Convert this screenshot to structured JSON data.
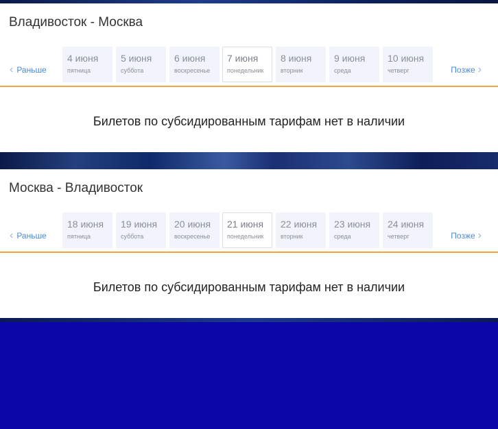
{
  "sections": [
    {
      "route": "Владивосток - Москва",
      "prev_label": "Раньше",
      "next_label": "Позже",
      "dates": [
        {
          "date": "4 июня",
          "weekday": "пятница"
        },
        {
          "date": "5 июня",
          "weekday": "суббота"
        },
        {
          "date": "6 июня",
          "weekday": "воскресенье"
        },
        {
          "date": "7 июня",
          "weekday": "понедельник"
        },
        {
          "date": "8 июня",
          "weekday": "вторник"
        },
        {
          "date": "9 июня",
          "weekday": "среда"
        },
        {
          "date": "10 июня",
          "weekday": "четверг"
        }
      ],
      "message": "Билетов по субсидированным тарифам нет в наличии"
    },
    {
      "route": "Москва - Владивосток",
      "prev_label": "Раньше",
      "next_label": "Позже",
      "dates": [
        {
          "date": "18 июня",
          "weekday": "пятница"
        },
        {
          "date": "19 июня",
          "weekday": "суббота"
        },
        {
          "date": "20 июня",
          "weekday": "воскресенье"
        },
        {
          "date": "21 июня",
          "weekday": "понедельник"
        },
        {
          "date": "22 июня",
          "weekday": "вторник"
        },
        {
          "date": "23 июня",
          "weekday": "среда"
        },
        {
          "date": "24 июня",
          "weekday": "четверг"
        }
      ],
      "message": "Билетов по субсидированным тарифам нет в наличии"
    }
  ],
  "icons": {
    "prev": "chevron-left-icon",
    "next": "chevron-right-icon"
  },
  "colors": {
    "accent_line": "#f0a142",
    "link": "#4a8ad8",
    "background": "#0a06a8"
  }
}
